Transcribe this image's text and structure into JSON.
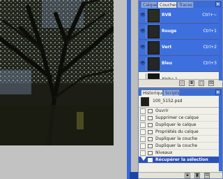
{
  "channels_panel": {
    "tabs": [
      "Calques",
      "Couches",
      "Traces"
    ],
    "active_tab": "Couches",
    "rows": [
      {
        "name": "RVB",
        "shortcut": "Ctrl+~",
        "selected": true,
        "visible": true
      },
      {
        "name": "Rouge",
        "shortcut": "Ctrl+1",
        "selected": true,
        "visible": true
      },
      {
        "name": "Vert",
        "shortcut": "Ctrl+2",
        "selected": true,
        "visible": true
      },
      {
        "name": "Bleu",
        "shortcut": "Ctrl+3",
        "selected": true,
        "visible": true
      },
      {
        "name": "Alpha 1",
        "shortcut": "",
        "selected": false,
        "visible": false
      }
    ],
    "footer_icons": [
      "load-selection-icon",
      "save-selection-icon",
      "new-channel-icon",
      "trash-icon"
    ]
  },
  "history_panel": {
    "tabs": [
      "Historique",
      "Scripts"
    ],
    "active_tab": "Historique",
    "snapshot": "100_5152.psd",
    "steps": [
      "Ouvrir",
      "Supprimer ce calque",
      "Dupliquer le calque",
      "Propriétés du calque",
      "Dupliquer la couche",
      "Dupliquer la couche",
      "Niveaux",
      "Récupérer la sélection"
    ],
    "selected_step": "Récupérer la sélection",
    "footer_icons": [
      "new-document-icon",
      "snapshot-icon",
      "trash-icon"
    ]
  },
  "colors": {
    "selection_blue": "#3d6fde",
    "titlebar_blue": "#3c6bd4",
    "panel_bg": "#f0efe8"
  }
}
